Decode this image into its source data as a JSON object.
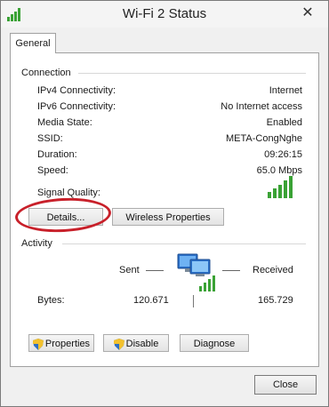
{
  "window": {
    "title": "Wi-Fi 2 Status",
    "close_glyph": "✕"
  },
  "tabs": [
    {
      "label": "General"
    }
  ],
  "connection": {
    "group_title": "Connection",
    "rows": [
      {
        "label": "IPv4 Connectivity:",
        "value": "Internet"
      },
      {
        "label": "IPv6 Connectivity:",
        "value": "No Internet access"
      },
      {
        "label": "Media State:",
        "value": "Enabled"
      },
      {
        "label": "SSID:",
        "value": "META-CongNghe"
      },
      {
        "label": "Duration:",
        "value": "09:26:15"
      },
      {
        "label": "Speed:",
        "value": "65.0 Mbps"
      }
    ],
    "signal_label": "Signal Quality:",
    "signal_bars_lit": 5,
    "details_button": "Details...",
    "wireless_button": "Wireless Properties"
  },
  "activity": {
    "group_title": "Activity",
    "sent_label": "Sent",
    "received_label": "Received",
    "bytes_label": "Bytes:",
    "bytes_sent": "120.671",
    "bytes_received": "165.729"
  },
  "buttons": {
    "properties": "Properties",
    "disable": "Disable",
    "diagnose": "Diagnose",
    "close": "Close"
  },
  "colors": {
    "signal_green": "#3aa235",
    "annotation_red": "#c8202a",
    "shield_blue": "#2e6fc4",
    "shield_yellow": "#f2c12e"
  },
  "icons": {
    "title": "wifi-signal-icon",
    "network": "network-computers-icon",
    "shield": "uac-shield-icon"
  }
}
